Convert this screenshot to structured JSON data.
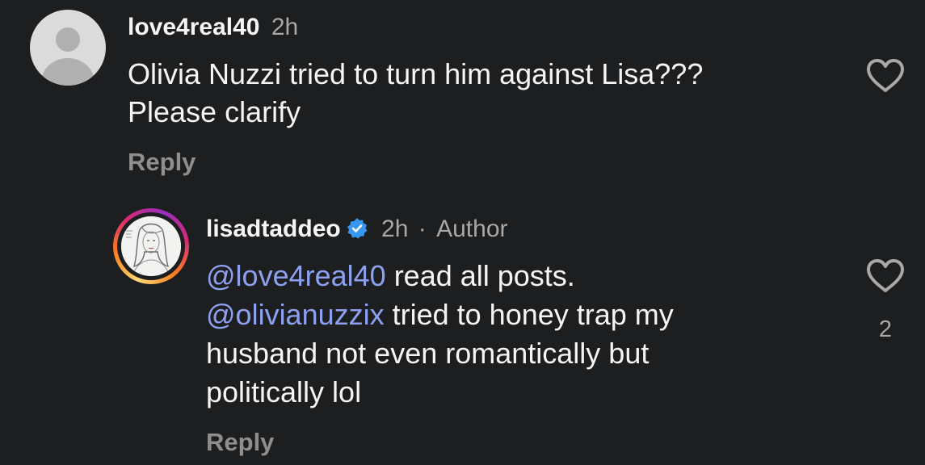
{
  "comments": [
    {
      "username": "love4real40",
      "time": "2h",
      "text_lines": [
        "Olivia Nuzzi tried to turn him against Lisa???",
        "Please clarify"
      ],
      "reply_label": "Reply",
      "avatar_icon": "default-avatar-icon",
      "like_icon": "heart-outline-icon"
    },
    {
      "username": "lisadtaddeo",
      "verified": true,
      "verified_icon": "verified-badge-icon",
      "time": "2h",
      "separator": "·",
      "author_tag": "Author",
      "line1_mention": "@love4real40",
      "line1_rest": " read all posts.",
      "line2_mention": "@olivianuzzix",
      "line2_rest": " tried to honey trap my",
      "line3": "husband not even romantically but",
      "line4": "politically lol",
      "reply_label": "Reply",
      "like_icon": "heart-outline-icon",
      "like_count": "2",
      "colors": {
        "mention": "#8ea1f0",
        "verified": "#3897f0"
      }
    }
  ]
}
